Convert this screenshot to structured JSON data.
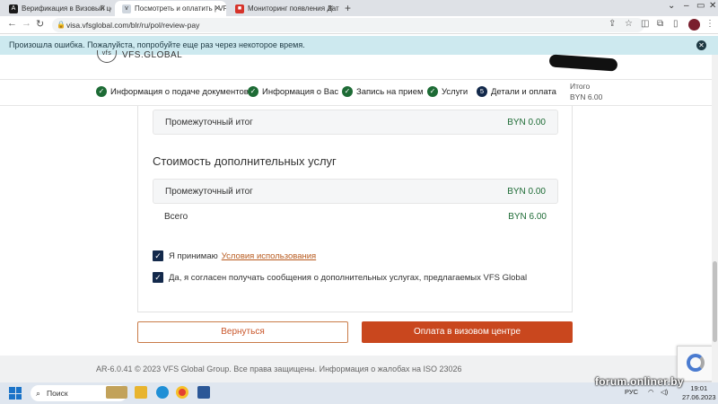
{
  "browser": {
    "tabs": [
      {
        "label": "Верификация в Визовый центр",
        "icon": "a-icon"
      },
      {
        "label": "Посмотреть и оплатить | VFS Gl",
        "icon": "vfs-icon"
      },
      {
        "label": "Мониторинг появления Дат на",
        "icon": "monitor-icon"
      }
    ],
    "new_tab": "+",
    "url": "visa.vfsglobal.com/blr/ru/pol/review-pay"
  },
  "banner": {
    "message": "Произошла ошибка. Пожалуйста, попробуйте еще раз через некоторое время.",
    "close": "✕"
  },
  "header": {
    "logo": "VFS.GLOBAL"
  },
  "steps": [
    {
      "label": "Информация о подаче документов",
      "state": "done"
    },
    {
      "label": "Информация о Вас",
      "state": "done"
    },
    {
      "label": "Запись на прием",
      "state": "done"
    },
    {
      "label": "Услуги",
      "state": "done"
    },
    {
      "label": "Детали и оплата",
      "state": "current",
      "number": "5"
    }
  ],
  "total": {
    "label": "Итого",
    "value": "BYN 6.00"
  },
  "main": {
    "subtotal_top": {
      "label": "Промежуточный итог",
      "value": "BYN 0.00"
    },
    "section_title": "Стоимость дополнительных услуг",
    "subtotal": {
      "label": "Промежуточный итог",
      "value": "BYN 0.00"
    },
    "grand_total": {
      "label": "Всего",
      "value": "BYN 6.00"
    },
    "consent_terms": {
      "text": "Я принимаю",
      "link": "Условия использования",
      "checked": true
    },
    "consent_marketing": {
      "text": "Да, я согласен получать сообщения о дополнительных услугах, предлагаемых VFS Global",
      "checked": true
    }
  },
  "actions": {
    "back": "Вернуться",
    "pay": "Оплата в визовом центре"
  },
  "footer": {
    "text": "AR-6.0.41 © 2023 VFS Global Group. Все права защищены. Информация о жалобах на ISO 23026"
  },
  "taskbar": {
    "search": "Поиск",
    "lang": "РУС",
    "time": "19:01",
    "date": "27.06.2023"
  },
  "watermark": "forum.onliner.by",
  "colors": {
    "accent": "#c9471e",
    "success": "#1d6b35",
    "navy": "#13294b",
    "banner": "#cde9ef"
  }
}
